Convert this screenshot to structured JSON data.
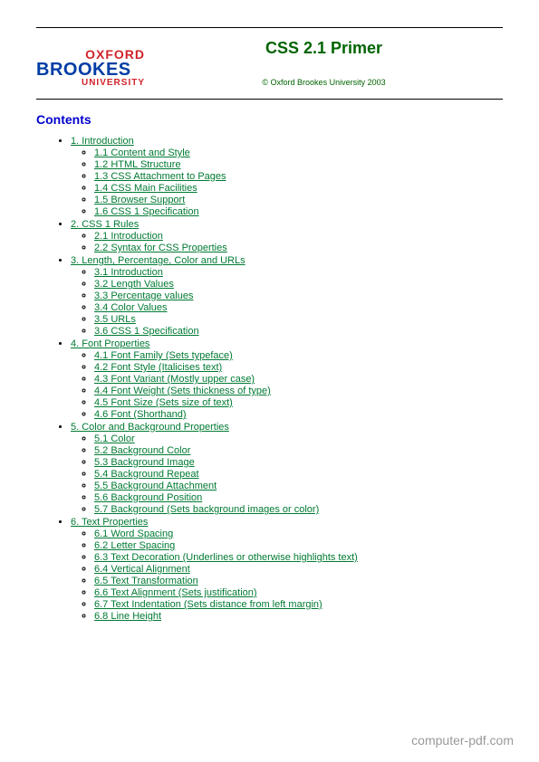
{
  "logo": {
    "line1": "OXFORD",
    "line2": "BROOKES",
    "line3": "UNIVERSITY"
  },
  "title": "CSS 2.1 Primer",
  "copyright": "© Oxford Brookes University 2003",
  "contentsHeading": "Contents",
  "toc": [
    {
      "label": "1. Introduction",
      "children": [
        "1.1 Content and Style",
        "1.2 HTML Structure",
        "1.3 CSS Attachment to Pages",
        "1.4 CSS Main Facilities",
        "1.5 Browser Support",
        "1.6 CSS 1 Specification"
      ]
    },
    {
      "label": "2. CSS 1 Rules",
      "children": [
        "2.1 Introduction",
        "2.2 Syntax for CSS Properties"
      ]
    },
    {
      "label": "3. Length, Percentage, Color and URLs",
      "children": [
        "3.1 Introduction",
        "3.2 Length Values",
        "3.3 Percentage values",
        "3.4 Color Values",
        "3.5 URLs",
        "3.6 CSS 1 Specification"
      ]
    },
    {
      "label": "4. Font Properties",
      "children": [
        "4.1 Font Family (Sets typeface)",
        "4.2 Font Style (Italicises text)",
        "4.3 Font Variant (Mostly upper case)",
        "4.4 Font Weight (Sets thickness of type)",
        "4.5 Font Size (Sets size of text)",
        "4.6 Font (Shorthand)"
      ]
    },
    {
      "label": "5. Color and Background Properties",
      "children": [
        "5.1 Color",
        "5.2 Background Color",
        "5.3 Background Image",
        "5.4 Background Repeat",
        "5.5 Background Attachment",
        "5.6 Background Position",
        "5.7 Background (Sets background images or color)"
      ]
    },
    {
      "label": "6. Text Properties",
      "children": [
        "6.1 Word Spacing",
        "6.2 Letter Spacing",
        "6.3 Text Decoration (Underlines or otherwise highlights text)",
        "6.4 Vertical Alignment",
        "6.5 Text Transformation",
        "6.6 Text Alignment (Sets justification)",
        "6.7 Text Indentation (Sets distance from left margin)",
        "6.8 Line Height"
      ]
    }
  ],
  "footer": "computer-pdf.com"
}
